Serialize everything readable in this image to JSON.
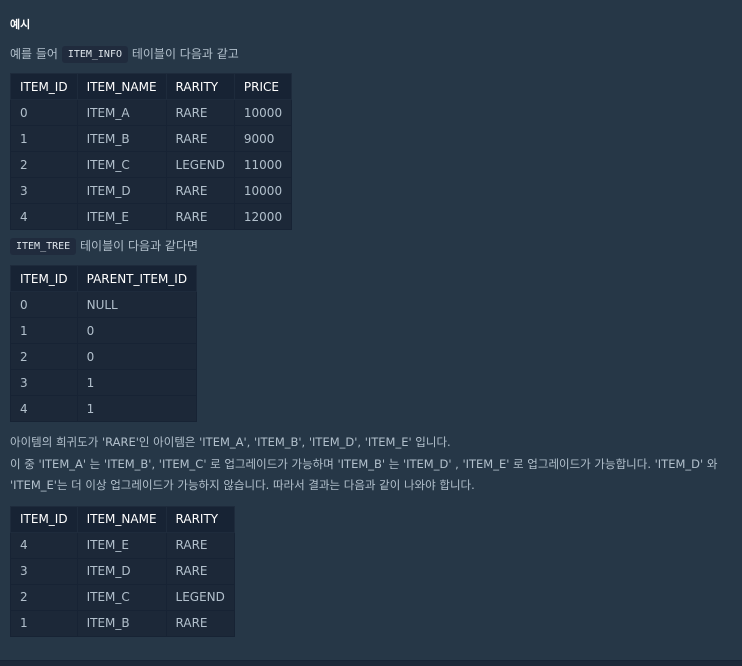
{
  "heading": "예시",
  "intro": {
    "prefix": "예를 들어",
    "code": "ITEM_INFO",
    "suffix": "테이블이 다음과 같고"
  },
  "item_info": {
    "headers": [
      "ITEM_ID",
      "ITEM_NAME",
      "RARITY",
      "PRICE"
    ],
    "rows": [
      [
        "0",
        "ITEM_A",
        "RARE",
        "10000"
      ],
      [
        "1",
        "ITEM_B",
        "RARE",
        "9000"
      ],
      [
        "2",
        "ITEM_C",
        "LEGEND",
        "11000"
      ],
      [
        "3",
        "ITEM_D",
        "RARE",
        "10000"
      ],
      [
        "4",
        "ITEM_E",
        "RARE",
        "12000"
      ]
    ]
  },
  "tree_intro": {
    "code": "ITEM_TREE",
    "suffix": "테이블이 다음과 같다면"
  },
  "item_tree": {
    "headers": [
      "ITEM_ID",
      "PARENT_ITEM_ID"
    ],
    "rows": [
      [
        "0",
        "NULL"
      ],
      [
        "1",
        "0"
      ],
      [
        "2",
        "0"
      ],
      [
        "3",
        "1"
      ],
      [
        "4",
        "1"
      ]
    ]
  },
  "explanation": {
    "line1": "아이템의 희귀도가 'RARE'인 아이템은 'ITEM_A', 'ITEM_B', 'ITEM_D', 'ITEM_E' 입니다.",
    "line2": "이 중 'ITEM_A' 는 'ITEM_B', 'ITEM_C' 로 업그레이드가 가능하며 'ITEM_B' 는 'ITEM_D' , 'ITEM_E' 로 업그레이드가 가능합니다. 'ITEM_D' 와",
    "line3": "'ITEM_E'는 더 이상 업그레이드가 가능하지 않습니다. 따라서 결과는 다음과 같이 나와야 합니다."
  },
  "result": {
    "headers": [
      "ITEM_ID",
      "ITEM_NAME",
      "RARITY"
    ],
    "rows": [
      [
        "4",
        "ITEM_E",
        "RARE"
      ],
      [
        "3",
        "ITEM_D",
        "RARE"
      ],
      [
        "2",
        "ITEM_C",
        "LEGEND"
      ],
      [
        "1",
        "ITEM_B",
        "RARE"
      ]
    ]
  }
}
